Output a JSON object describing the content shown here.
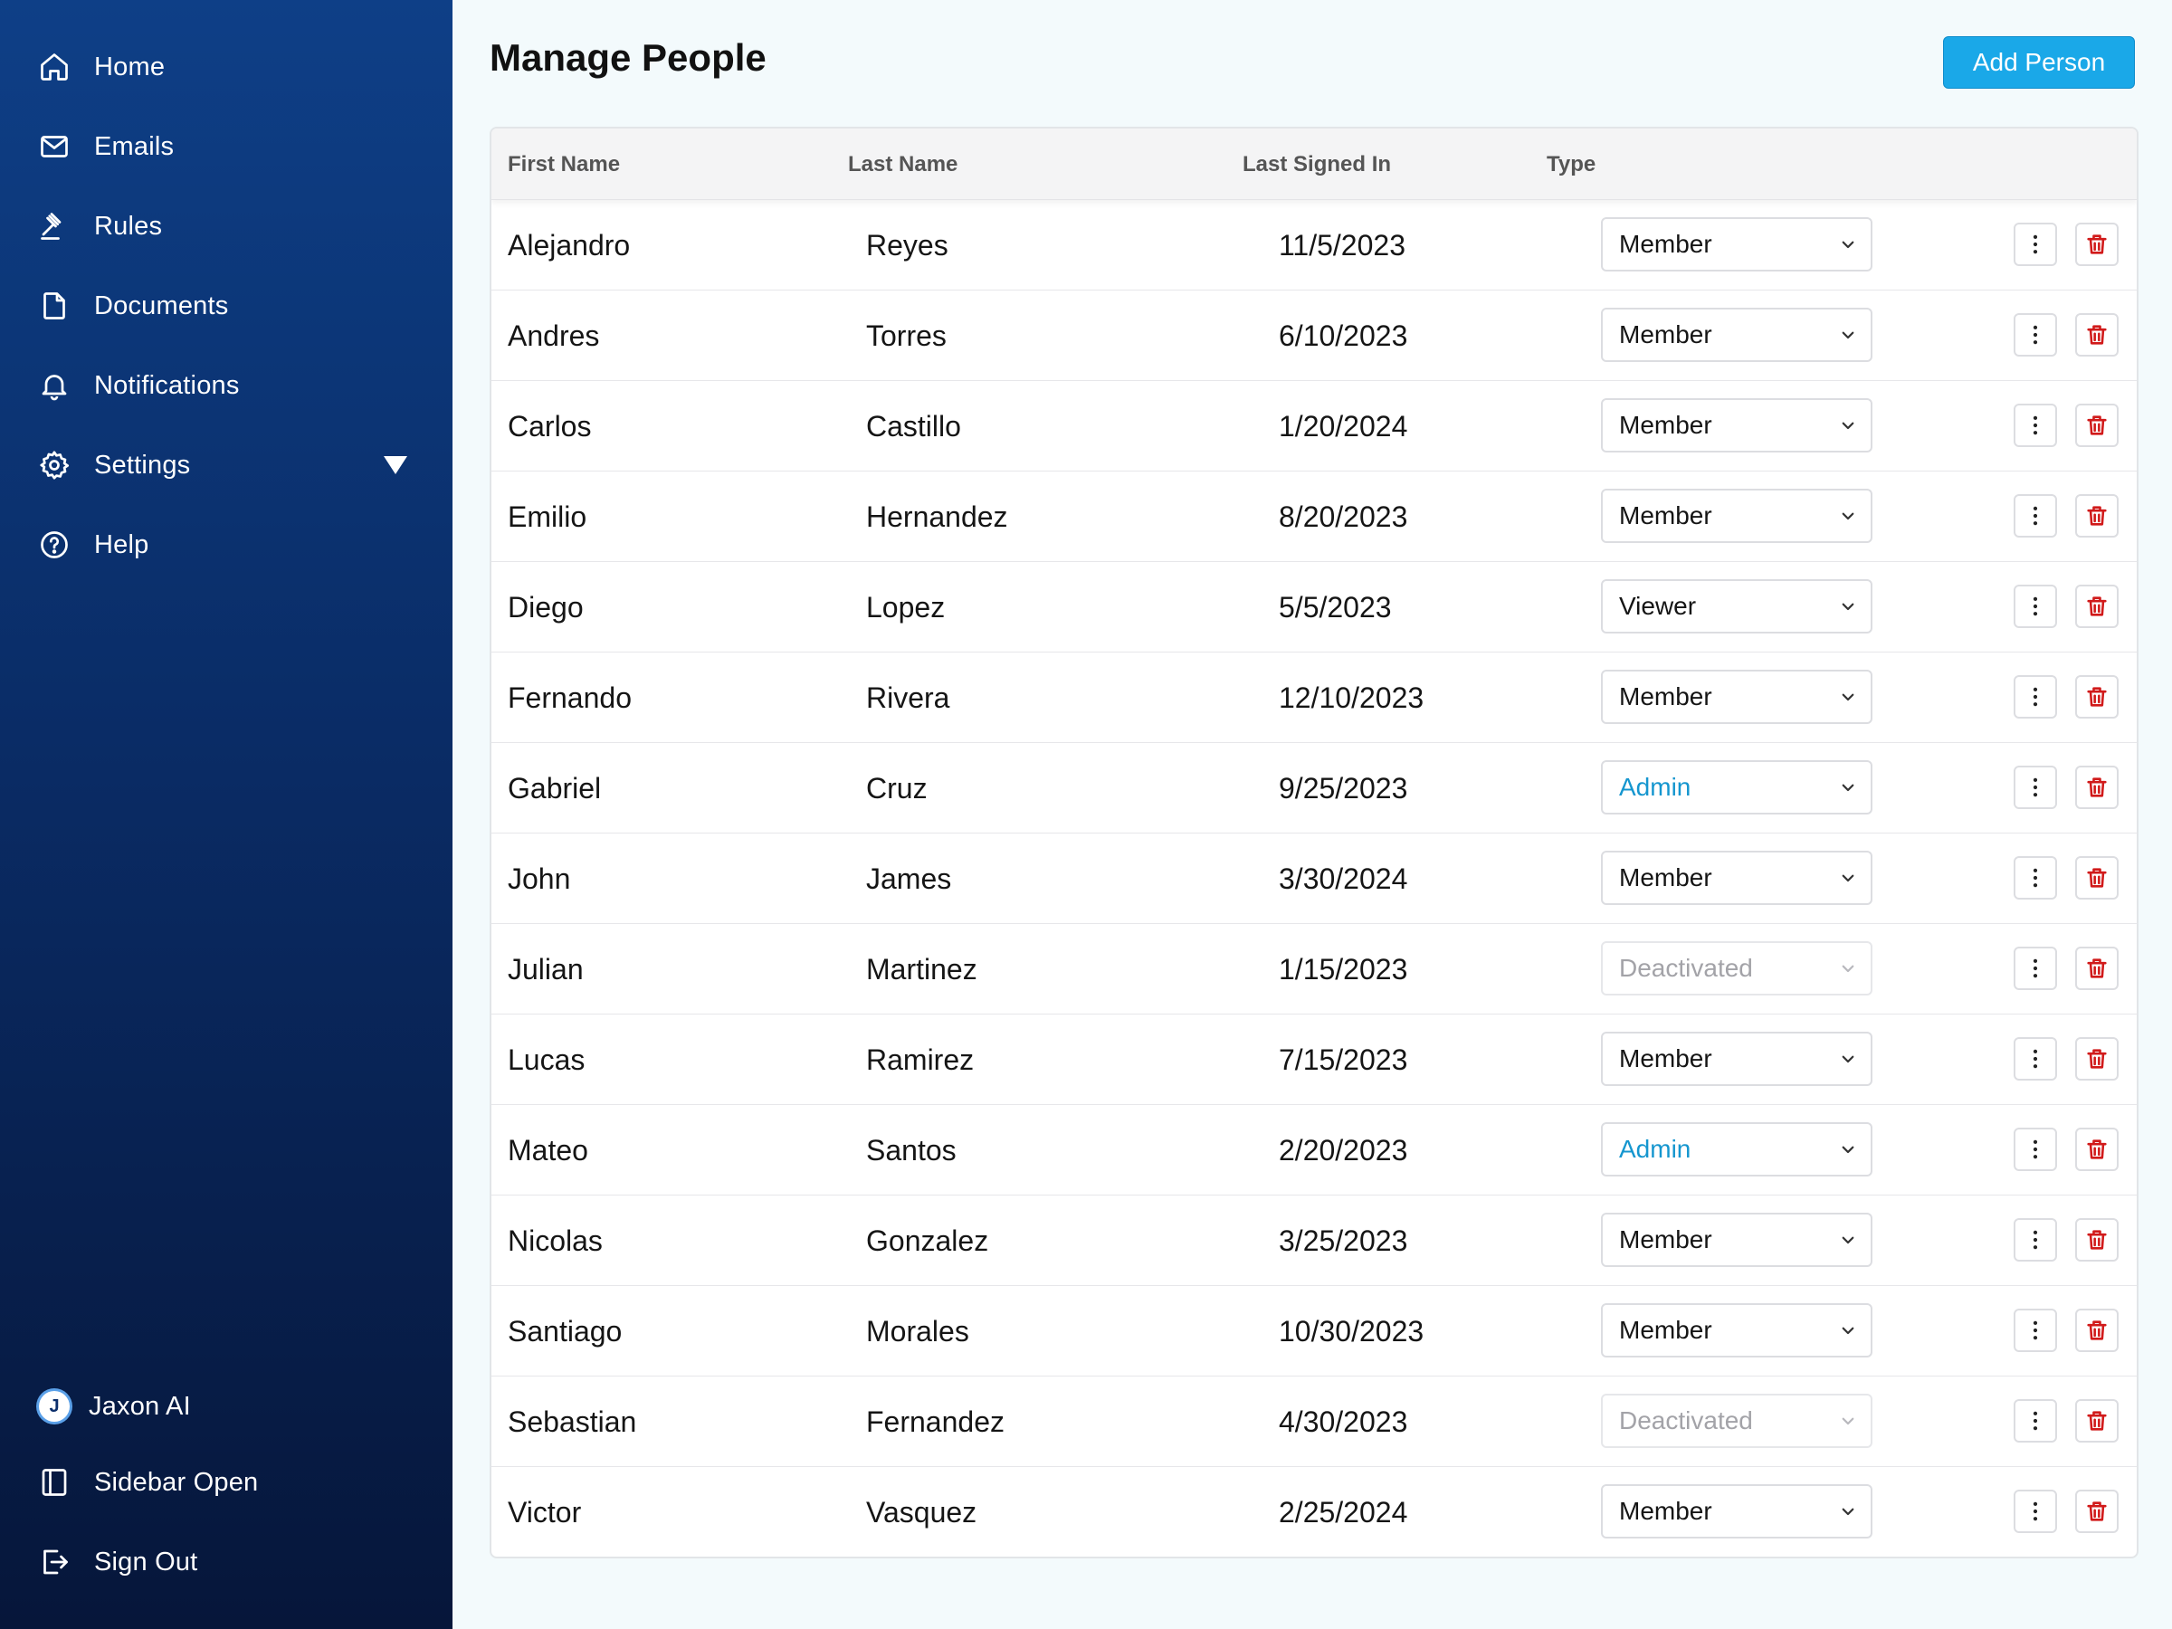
{
  "sidebar": {
    "nav": [
      {
        "label": "Home",
        "icon": "home-icon"
      },
      {
        "label": "Emails",
        "icon": "mail-icon"
      },
      {
        "label": "Rules",
        "icon": "gavel-icon"
      },
      {
        "label": "Documents",
        "icon": "document-icon"
      },
      {
        "label": "Notifications",
        "icon": "bell-icon"
      },
      {
        "label": "Settings",
        "icon": "gear-icon"
      },
      {
        "label": "Help",
        "icon": "help-icon"
      }
    ],
    "bottom": [
      {
        "label": "Jaxon AI",
        "avatar_letter": "J"
      },
      {
        "label": "Sidebar Open",
        "icon": "sidebar-icon"
      },
      {
        "label": "Sign Out",
        "icon": "sign-out-icon"
      }
    ],
    "gradient_top": "#0e3f87",
    "gradient_bottom": "#06163a"
  },
  "header": {
    "title": "Manage People",
    "add_button": "Add Person",
    "accent": "#1aa8e8"
  },
  "table": {
    "columns": [
      "First Name",
      "Last Name",
      "Last Signed In",
      "Type"
    ],
    "rows": [
      {
        "first": "Alejandro",
        "last": "Reyes",
        "signed_in": "11/5/2023",
        "type": "Member"
      },
      {
        "first": "Andres",
        "last": "Torres",
        "signed_in": "6/10/2023",
        "type": "Member"
      },
      {
        "first": "Carlos",
        "last": "Castillo",
        "signed_in": "1/20/2024",
        "type": "Member"
      },
      {
        "first": "Emilio",
        "last": "Hernandez",
        "signed_in": "8/20/2023",
        "type": "Member"
      },
      {
        "first": "Diego",
        "last": "Lopez",
        "signed_in": "5/5/2023",
        "type": "Viewer"
      },
      {
        "first": "Fernando",
        "last": "Rivera",
        "signed_in": "12/10/2023",
        "type": "Member"
      },
      {
        "first": "Gabriel",
        "last": "Cruz",
        "signed_in": "9/25/2023",
        "type": "Admin"
      },
      {
        "first": "John",
        "last": "James",
        "signed_in": "3/30/2024",
        "type": "Member"
      },
      {
        "first": "Julian",
        "last": "Martinez",
        "signed_in": "1/15/2023",
        "type": "Deactivated"
      },
      {
        "first": "Lucas",
        "last": "Ramirez",
        "signed_in": "7/15/2023",
        "type": "Member"
      },
      {
        "first": "Mateo",
        "last": "Santos",
        "signed_in": "2/20/2023",
        "type": "Admin"
      },
      {
        "first": "Nicolas",
        "last": "Gonzalez",
        "signed_in": "3/25/2023",
        "type": "Member"
      },
      {
        "first": "Santiago",
        "last": "Morales",
        "signed_in": "10/30/2023",
        "type": "Member"
      },
      {
        "first": "Sebastian",
        "last": "Fernandez",
        "signed_in": "4/30/2023",
        "type": "Deactivated"
      },
      {
        "first": "Victor",
        "last": "Vasquez",
        "signed_in": "2/25/2024",
        "type": "Member"
      }
    ],
    "colors": {
      "admin": "#1596cf",
      "deactivated": "#a3a3a8",
      "delete": "#d11a1a"
    }
  }
}
